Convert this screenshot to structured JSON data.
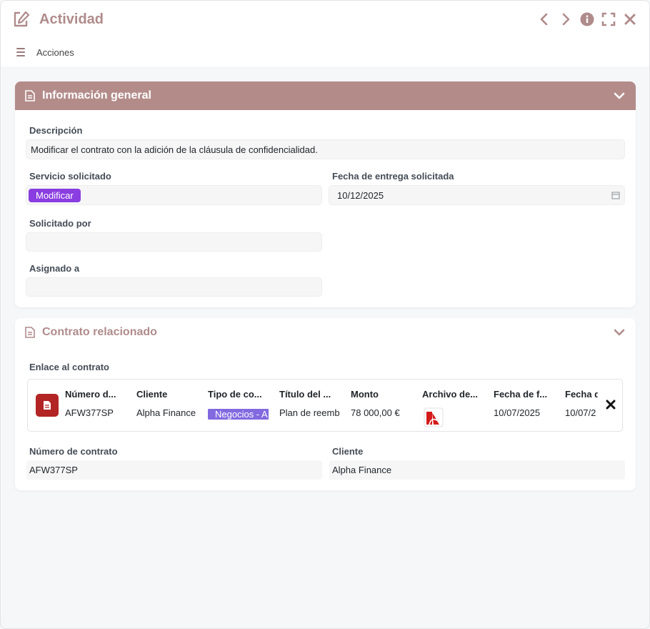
{
  "window": {
    "title": "Actividad"
  },
  "toolbar": {
    "actions_label": "Acciones"
  },
  "general": {
    "header": "Información general",
    "description": {
      "label": "Descripción",
      "value": "Modificar el contrato con la adición de la cláusula de confidencialidad."
    },
    "service": {
      "label": "Servicio solicitado",
      "chip": "Modificar"
    },
    "delivery": {
      "label": "Fecha de entrega solicitada",
      "value": "10/12/2025"
    },
    "requested_by": {
      "label": "Solicitado por",
      "value": ""
    },
    "assigned_to": {
      "label": "Asignado a",
      "value": ""
    }
  },
  "contract": {
    "header": "Contrato relacionado",
    "link_label": "Enlace al contrato",
    "columns": [
      {
        "header": "Número d...",
        "value": "AFW377SP"
      },
      {
        "header": "Cliente",
        "value": "Alpha Finance"
      },
      {
        "header": "Tipo de co...",
        "value": "Negocios - A"
      },
      {
        "header": "Título del ...",
        "value": "Plan de reemb"
      },
      {
        "header": "Monto",
        "value": "78 000,00 €"
      },
      {
        "header": "Archivo de...",
        "value": ""
      },
      {
        "header": "Fecha de f...",
        "value": "10/07/2025"
      },
      {
        "header": "Fecha d",
        "value": "10/07/2"
      }
    ],
    "number": {
      "label": "Número de contrato",
      "value": "AFW377SP"
    },
    "client": {
      "label": "Cliente",
      "value": "Alpha Finance"
    }
  },
  "colors": {
    "accent": "#b38c8a",
    "chip_service": "#8a3de0",
    "chip_type": "#8269e0",
    "pdf_red": "#b32424"
  },
  "icons": [
    "edit-icon",
    "chevron-left-icon",
    "chevron-right-icon",
    "info-icon",
    "fullscreen-icon",
    "close-icon",
    "menu-icon",
    "document-icon",
    "chevron-down-icon",
    "calendar-icon",
    "pdf-icon",
    "remove-icon"
  ]
}
